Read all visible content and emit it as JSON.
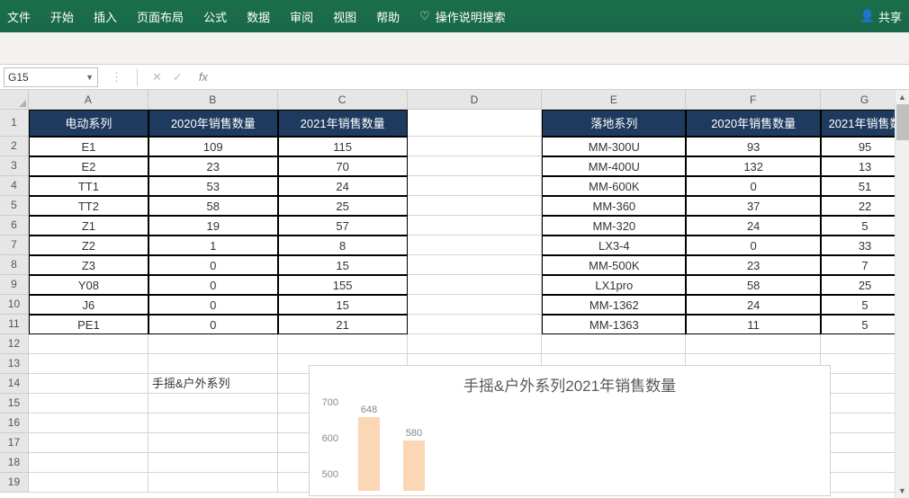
{
  "ribbon": {
    "tabs": [
      "文件",
      "开始",
      "插入",
      "页面布局",
      "公式",
      "数据",
      "审阅",
      "视图",
      "帮助"
    ],
    "search_label": "操作说明搜索",
    "share_label": "共享"
  },
  "name_box": {
    "value": "G15"
  },
  "columns": [
    "A",
    "B",
    "C",
    "D",
    "E",
    "F",
    "G"
  ],
  "col_widths": [
    "cA",
    "cB",
    "cC",
    "cD",
    "cE",
    "cF",
    "cG"
  ],
  "table1": {
    "headers": [
      "电动系列",
      "2020年销售数量",
      "2021年销售数量"
    ],
    "rows": [
      [
        "E1",
        "109",
        "115"
      ],
      [
        "E2",
        "23",
        "70"
      ],
      [
        "TT1",
        "53",
        "24"
      ],
      [
        "TT2",
        "58",
        "25"
      ],
      [
        "Z1",
        "19",
        "57"
      ],
      [
        "Z2",
        "1",
        "8"
      ],
      [
        "Z3",
        "0",
        "15"
      ],
      [
        "Y08",
        "0",
        "155"
      ],
      [
        "J6",
        "0",
        "15"
      ],
      [
        "PE1",
        "0",
        "21"
      ]
    ]
  },
  "table2": {
    "headers": [
      "落地系列",
      "2020年销售数量",
      "2021年销售数"
    ],
    "rows": [
      [
        "MM-300U",
        "93",
        "95"
      ],
      [
        "MM-400U",
        "132",
        "13"
      ],
      [
        "MM-600K",
        "0",
        "51"
      ],
      [
        "MM-360",
        "37",
        "22"
      ],
      [
        "MM-320",
        "24",
        "5"
      ],
      [
        "LX3-4",
        "0",
        "33"
      ],
      [
        "MM-500K",
        "23",
        "7"
      ],
      [
        "LX1pro",
        "58",
        "25"
      ],
      [
        "MM-1362",
        "24",
        "5"
      ],
      [
        "MM-1363",
        "11",
        "5"
      ]
    ]
  },
  "label_b14": "手摇&户外系列",
  "chart_data": {
    "type": "bar",
    "title": "手摇&户外系列2021年销售数量",
    "y_ticks": [
      700,
      600,
      500
    ],
    "ylim": [
      0,
      700
    ],
    "series": [
      {
        "name": "",
        "values": [
          648,
          580
        ]
      }
    ],
    "categories": [
      "",
      ""
    ],
    "xlabel": "",
    "ylabel": ""
  },
  "row_numbers": [
    1,
    2,
    3,
    4,
    5,
    6,
    7,
    8,
    9,
    10,
    11,
    12,
    13,
    14,
    15,
    16,
    17,
    18,
    19
  ]
}
